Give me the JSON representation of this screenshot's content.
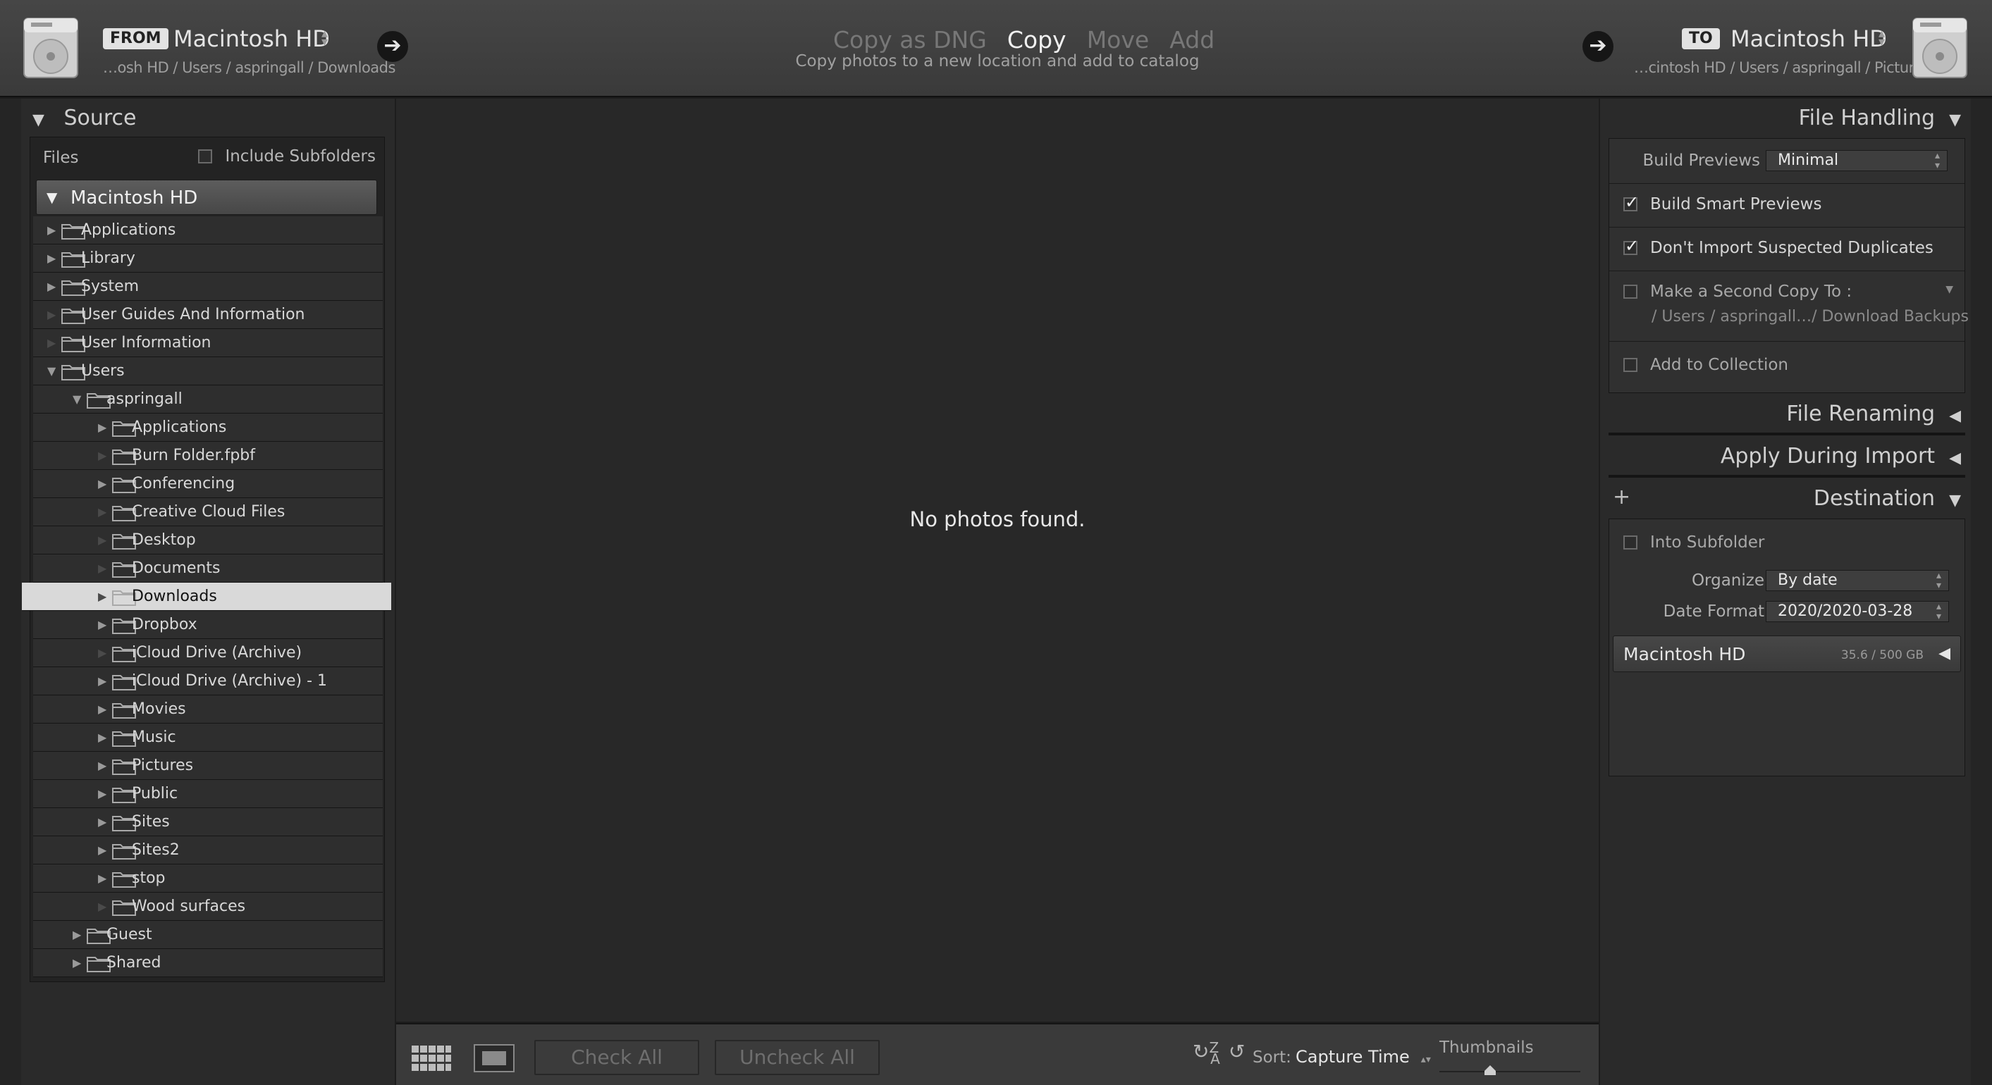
{
  "topbar": {
    "from_badge": "FROM",
    "from_volume": "Macintosh HD",
    "from_path": "…osh HD / Users / aspringall / Downloads",
    "modes": [
      "Copy as DNG",
      "Copy",
      "Move",
      "Add"
    ],
    "active_mode": "Copy",
    "mode_description": "Copy photos to a new location and add to catalog",
    "to_badge": "TO",
    "to_volume": "Macintosh HD",
    "to_path": "…cintosh HD / Users / aspringall / Pictures"
  },
  "source": {
    "header": "Source",
    "files_label": "Files",
    "include_subfolders": "Include Subfolders",
    "include_subfolders_checked": false,
    "disk": "Macintosh HD",
    "tree": [
      {
        "label": "Applications",
        "depth": 0,
        "expander": "collapsed"
      },
      {
        "label": "Library",
        "depth": 0,
        "expander": "collapsed"
      },
      {
        "label": "System",
        "depth": 0,
        "expander": "collapsed"
      },
      {
        "label": "User Guides And Information",
        "depth": 0,
        "expander": "none"
      },
      {
        "label": "User Information",
        "depth": 0,
        "expander": "none"
      },
      {
        "label": "Users",
        "depth": 0,
        "expander": "expanded"
      },
      {
        "label": "aspringall",
        "depth": 1,
        "expander": "expanded"
      },
      {
        "label": "Applications",
        "depth": 2,
        "expander": "collapsed"
      },
      {
        "label": "Burn Folder.fpbf",
        "depth": 2,
        "expander": "none"
      },
      {
        "label": "Conferencing",
        "depth": 2,
        "expander": "collapsed"
      },
      {
        "label": "Creative Cloud Files",
        "depth": 2,
        "expander": "none"
      },
      {
        "label": "Desktop",
        "depth": 2,
        "expander": "none"
      },
      {
        "label": "Documents",
        "depth": 2,
        "expander": "none"
      },
      {
        "label": "Downloads",
        "depth": 2,
        "expander": "none",
        "selected": true
      },
      {
        "label": "Dropbox",
        "depth": 2,
        "expander": "collapsed"
      },
      {
        "label": "iCloud Drive (Archive)",
        "depth": 2,
        "expander": "none"
      },
      {
        "label": "iCloud Drive (Archive) - 1",
        "depth": 2,
        "expander": "collapsed"
      },
      {
        "label": "Movies",
        "depth": 2,
        "expander": "collapsed"
      },
      {
        "label": "Music",
        "depth": 2,
        "expander": "collapsed"
      },
      {
        "label": "Pictures",
        "depth": 2,
        "expander": "collapsed"
      },
      {
        "label": "Public",
        "depth": 2,
        "expander": "collapsed"
      },
      {
        "label": "Sites",
        "depth": 2,
        "expander": "collapsed"
      },
      {
        "label": "Sites2",
        "depth": 2,
        "expander": "collapsed"
      },
      {
        "label": "stop",
        "depth": 2,
        "expander": "collapsed"
      },
      {
        "label": "Wood surfaces",
        "depth": 2,
        "expander": "none"
      },
      {
        "label": "Guest",
        "depth": 1,
        "expander": "collapsed"
      },
      {
        "label": "Shared",
        "depth": 1,
        "expander": "collapsed"
      }
    ]
  },
  "center": {
    "empty_message": "No photos found."
  },
  "toolbar": {
    "check_all": "Check All",
    "uncheck_all": "Uncheck All",
    "sort_label": "Sort:",
    "sort_value": "Capture Time",
    "thumbnails_label": "Thumbnails"
  },
  "file_handling": {
    "header": "File Handling",
    "build_previews_label": "Build Previews",
    "build_previews_value": "Minimal",
    "build_smart_previews": "Build Smart Previews",
    "build_smart_previews_checked": true,
    "dont_import_duplicates": "Don't Import Suspected Duplicates",
    "dont_import_duplicates_checked": true,
    "second_copy": "Make a Second Copy To :",
    "second_copy_checked": false,
    "second_copy_path": "/ Users / aspringall…/ Download Backups",
    "add_to_collection": "Add to Collection",
    "add_to_collection_checked": false
  },
  "file_renaming": {
    "header": "File Renaming"
  },
  "apply_during_import": {
    "header": "Apply During Import"
  },
  "destination": {
    "header": "Destination",
    "into_subfolder": "Into Subfolder",
    "into_subfolder_checked": false,
    "organize_label": "Organize",
    "organize_value": "By date",
    "date_format_label": "Date Format",
    "date_format_value": "2020/2020-03-28",
    "disk_name": "Macintosh HD",
    "disk_space": "35.6 / 500 GB"
  },
  "icons": {
    "disk": "hard-drive-icon",
    "folder": "folder-icon",
    "arrow": "arrow-right-icon",
    "grid": "grid-view-icon",
    "loupe": "loupe-view-icon",
    "sort": "sort-az-icon"
  }
}
